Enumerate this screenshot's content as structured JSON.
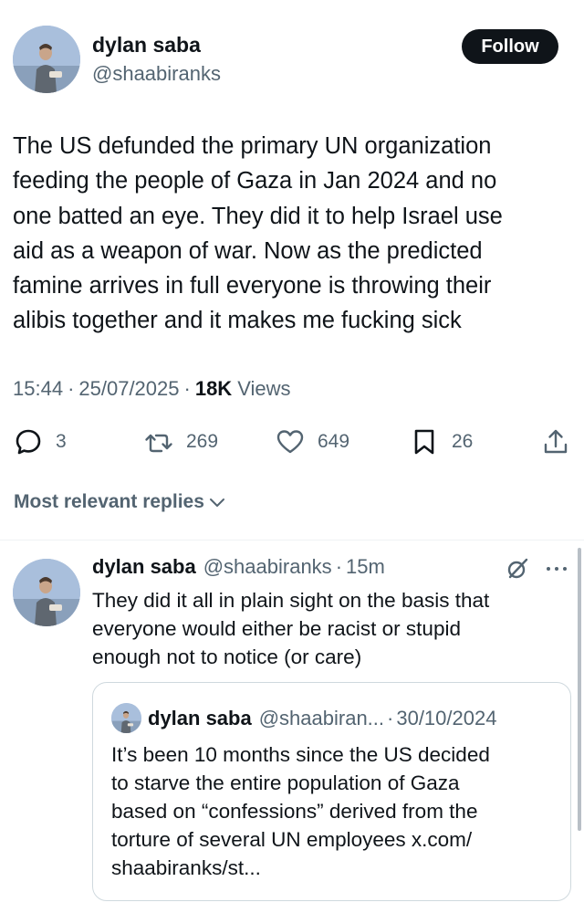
{
  "main_tweet": {
    "author_name": "dylan saba",
    "author_handle": "@shaabiranks",
    "follow_label": "Follow",
    "text": "The US defunded the primary UN organization\nfeeding the people of Gaza in Jan 2024 and no\none batted an eye. They did it to help Israel use\naid as a weapon of war. Now as the predicted\nfamine arrives in full everyone is throwing their\nalibis together and it makes me fucking sick",
    "time": "15:44",
    "date": "25/07/2025",
    "views_count": "18K",
    "views_label": "Views",
    "separator": "·"
  },
  "actions": {
    "replies": "3",
    "retweets": "269",
    "likes": "649",
    "bookmarks": "26"
  },
  "sort": {
    "label": "Most relevant replies"
  },
  "reply": {
    "author_name": "dylan saba",
    "author_handle": "@shaabiranks",
    "separator": "·",
    "time": "15m",
    "text": "They did it all in plain sight on the basis that\neveryone would either be racist or stupid\nenough not to notice (or care)",
    "quote": {
      "author_name": "dylan saba",
      "author_handle": "@shaabiran...",
      "separator": "·",
      "date": "30/10/2024",
      "text": "It’s been 10 months since the US decided\nto starve the entire population of Gaza\nbased on “confessions” derived from the\ntorture of several UN employees x.com/\nshaabiranks/st..."
    }
  },
  "icons": {
    "reply": "speech-bubble-icon",
    "retweet": "retweet-arrows-icon",
    "like": "heart-icon",
    "bookmark": "bookmark-icon",
    "share": "share-upload-icon",
    "grok": "grok-icon",
    "more": "more-dots-icon",
    "sort": "chevron-down-icon"
  },
  "colors": {
    "text_primary": "#0f1419",
    "text_secondary": "#536471",
    "follow_bg": "#0f1419",
    "border": "#cfd9de"
  }
}
